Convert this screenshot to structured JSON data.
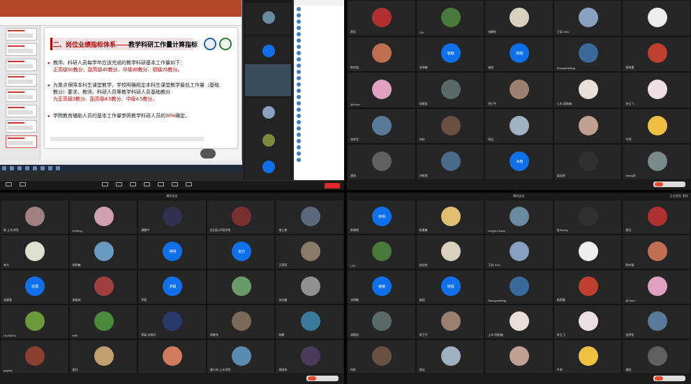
{
  "colors": {
    "zoom_blue": "#0e71eb",
    "ppt_red": "#b7472a",
    "slide_red": "#c00000",
    "end_red": "#e02828"
  },
  "ppt": {
    "slide": {
      "title_red": "二、岗位业绩指标体系——",
      "title_black": "教学科研工作量计算指标",
      "bullets": [
        {
          "text": "教师、科研人员每学年应该完成的教学科研基本工作量如下：",
          "red": "正高级60教分、副高级40教分、中级30教分、初级25教分。"
        },
        {
          "text": "为重点保障本科生课堂教学，学校明确规定本科生课堂教学最低工作量（基础教分）要求，教师、科研人员等教学科研人员基础教分",
          "red": "为正高级3教分、副高级4.5教分、中级4.5教分。"
        },
        {
          "text": "学院教育辅助人员的基本工作量参照教学科研人员的",
          "red": "30%",
          "tail": "确定。"
        }
      ]
    }
  },
  "gallery_right_top": {
    "tiles": [
      {
        "name": "蔡钰",
        "type": "photo",
        "color": "#b03030"
      },
      {
        "name": "LZh",
        "type": "photo",
        "color": "#4a7a3a"
      },
      {
        "name": "张静怡",
        "type": "photo",
        "color": "#d8d0c0"
      },
      {
        "name": "王凯-SHU",
        "type": "photo",
        "color": "#8aa0c0"
      },
      {
        "name": "",
        "type": "photo",
        "color": "#eeeeee"
      },
      {
        "name": "陈宗昌",
        "type": "photo",
        "color": "#c07050"
      },
      {
        "name": "沈明敏",
        "type": "blue",
        "label": "敏敏"
      },
      {
        "name": "施程",
        "type": "blue",
        "label": "晓程"
      },
      {
        "name": "ShunyanWang",
        "type": "photo",
        "color": "#3a6a9a"
      },
      {
        "name": "杨莉霞",
        "type": "photo",
        "color": "#c04030"
      },
      {
        "name": "@Yaon~",
        "type": "photo",
        "color": "#e0a0c0"
      },
      {
        "name": "胡燕凯",
        "type": "photo",
        "color": "#5a6a6a"
      },
      {
        "name": "钟卫平",
        "type": "photo",
        "color": "#9a8070"
      },
      {
        "name": "土木-程和楠",
        "type": "photo",
        "color": "#e8e0d8"
      },
      {
        "name": "李玉飞",
        "type": "photo",
        "color": "#eee0e0"
      },
      {
        "name": "张梦亚",
        "type": "photo",
        "color": "#5a7a9a"
      },
      {
        "name": "徐秋",
        "type": "photo",
        "color": "#6a5040"
      },
      {
        "name": "周远",
        "type": "photo",
        "color": "#a0b0c0"
      },
      {
        "name": "",
        "type": "photo",
        "color": "#c0a090"
      },
      {
        "name": "牛明",
        "type": "photo",
        "color": "#f0c040"
      },
      {
        "name": "潘张",
        "type": "photo",
        "color": "#606060"
      },
      {
        "name": "刘皓然",
        "type": "photo",
        "color": "#4a6a8a"
      },
      {
        "name": "",
        "type": "blue",
        "label": "冰皓"
      },
      {
        "name": "梁佳明",
        "type": "photo",
        "color": "#303030"
      },
      {
        "name": "Wang印",
        "type": "photo",
        "color": "#7a8a8a"
      }
    ]
  },
  "gallery_left_bottom": {
    "header": "腾讯会议",
    "tiles": [
      {
        "name": "陈-土木学院",
        "color": "#a08080"
      },
      {
        "name": "HuiXing",
        "color": "#d0a0b0"
      },
      {
        "name": "谭晨宇",
        "color": "#303050"
      },
      {
        "name": "金田田-环境学院",
        "color": "#7a3030"
      },
      {
        "name": "单江勇",
        "color": "#5a6a7a"
      },
      {
        "name": "李大",
        "color": "#e0e0d0"
      },
      {
        "name": "周明敏",
        "color": "#6a9ac0"
      },
      {
        "name": "",
        "label": "明明",
        "blue": true
      },
      {
        "name": "",
        "label": "俞方",
        "blue": true
      },
      {
        "name": "王莉莉",
        "color": "#8a7a6a"
      },
      {
        "name": "张蓉蓉",
        "label": "晓蓉",
        "blue": true
      },
      {
        "name": "谢蔚林",
        "color": "#a04040"
      },
      {
        "name": "罗毅",
        "label": "罗毅",
        "blue": true
      },
      {
        "name": "",
        "color": "#6a9a6a"
      },
      {
        "name": "张金晨",
        "color": "#909090"
      },
      {
        "name": "LiuZhiZhu",
        "color": "#6a9a3a"
      },
      {
        "name": "leMi",
        "color": "#4a8a3a"
      },
      {
        "name": "郑高-刘成功",
        "color": "#2a3a6a"
      },
      {
        "name": "周敬伟",
        "color": "#7a6a5a"
      },
      {
        "name": "陈鹏",
        "color": "#3a7a9a"
      },
      {
        "name": "paguAj",
        "color": "#8a4030"
      },
      {
        "name": "姜钰",
        "color": "#c0a070"
      },
      {
        "name": "",
        "color": "#d07a60"
      },
      {
        "name": "潘小伟-土木学院",
        "color": "#5a8ab0"
      },
      {
        "name": "周国伟",
        "color": "#4a3a5a"
      }
    ]
  },
  "gallery_right_bottom": {
    "header": "腾讯会议",
    "top_right": "正在讲话: 蔡钰",
    "tiles": [
      {
        "name": "陈晓明",
        "label": "晓明",
        "blue": true
      },
      {
        "name": "陈惠敏",
        "color": "#e0c070"
      },
      {
        "name": "Lingmi-Zhang",
        "color": "#6a8aa0"
      },
      {
        "name": "张Sianny",
        "color": "#303030"
      },
      {
        "name": "蔡钰",
        "color": "#b03030"
      },
      {
        "name": "LZh",
        "color": "#4a7a3a"
      },
      {
        "name": "张佳怡",
        "color": "#d8d0c0"
      },
      {
        "name": "王凯-SHU",
        "color": "#8aa0c0"
      },
      {
        "name": "",
        "color": "#eeeeee"
      },
      {
        "name": "陈宗昌",
        "color": "#c07050"
      },
      {
        "name": "沈明敏",
        "label": "敏敏",
        "blue": true
      },
      {
        "name": "施程",
        "label": "晓程",
        "blue": true
      },
      {
        "name": "ShunyanWang",
        "color": "#3a6a9a"
      },
      {
        "name": "杨莉霞",
        "color": "#c04030"
      },
      {
        "name": "@Yaon~",
        "color": "#e0a0c0"
      },
      {
        "name": "胡燕凯",
        "color": "#5a6a6a"
      },
      {
        "name": "钟卫平",
        "color": "#9a8070"
      },
      {
        "name": "土木-程和楠",
        "color": "#e8e0d8"
      },
      {
        "name": "李玉飞",
        "color": "#eee0e0"
      },
      {
        "name": "张梦亚",
        "color": "#5a7a9a"
      },
      {
        "name": "徐秋",
        "color": "#6a5040"
      },
      {
        "name": "周远",
        "color": "#a0b0c0"
      },
      {
        "name": "",
        "color": "#c0a090"
      },
      {
        "name": "牛明",
        "color": "#f0c040"
      },
      {
        "name": "潘张",
        "color": "#606060"
      }
    ]
  }
}
